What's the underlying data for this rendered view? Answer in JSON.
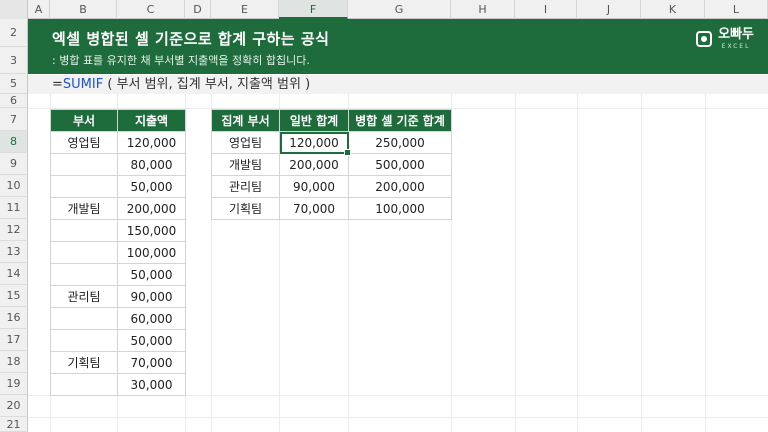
{
  "columns": [
    "A",
    "B",
    "C",
    "D",
    "E",
    "F",
    "G",
    "H",
    "I",
    "J",
    "K",
    "L"
  ],
  "rows": [
    "2",
    "3",
    "5",
    "6",
    "7",
    "8",
    "9",
    "10",
    "11",
    "12",
    "13",
    "14",
    "15",
    "16",
    "17",
    "18",
    "19",
    "20",
    "21"
  ],
  "banner": {
    "title": "엑셀 병합된 셀 기준으로 합계 구하는 공식",
    "subtitle": ": 병합 표를 유지한 채 부서별 지출액을 정확히 합칩니다.",
    "logo_text": "오빠두",
    "logo_sub": "EXCEL"
  },
  "formula": {
    "prefix": "=",
    "fn": "SUMIF",
    "args": " ( 부서 범위, 집계 부서, 지출액 범위 )"
  },
  "left_table": {
    "headers": [
      "부서",
      "지출액"
    ],
    "rows": [
      [
        "영업팀",
        "120,000"
      ],
      [
        "",
        "80,000"
      ],
      [
        "",
        "50,000"
      ],
      [
        "개발팀",
        "200,000"
      ],
      [
        "",
        "150,000"
      ],
      [
        "",
        "100,000"
      ],
      [
        "",
        "50,000"
      ],
      [
        "관리팀",
        "90,000"
      ],
      [
        "",
        "60,000"
      ],
      [
        "",
        "50,000"
      ],
      [
        "기획팀",
        "70,000"
      ],
      [
        "",
        "30,000"
      ]
    ]
  },
  "right_table": {
    "headers": [
      "집계 부서",
      "일반 합계",
      "병합 셀 기준 합계"
    ],
    "rows": [
      [
        "영업팀",
        "120,000",
        "250,000"
      ],
      [
        "개발팀",
        "200,000",
        "500,000"
      ],
      [
        "관리팀",
        "90,000",
        "200,000"
      ],
      [
        "기획팀",
        "70,000",
        "100,000"
      ]
    ]
  },
  "selected_cell": "F8",
  "colors": {
    "accent": "#1e6b3c",
    "formula_fn": "#1f4fd8"
  }
}
